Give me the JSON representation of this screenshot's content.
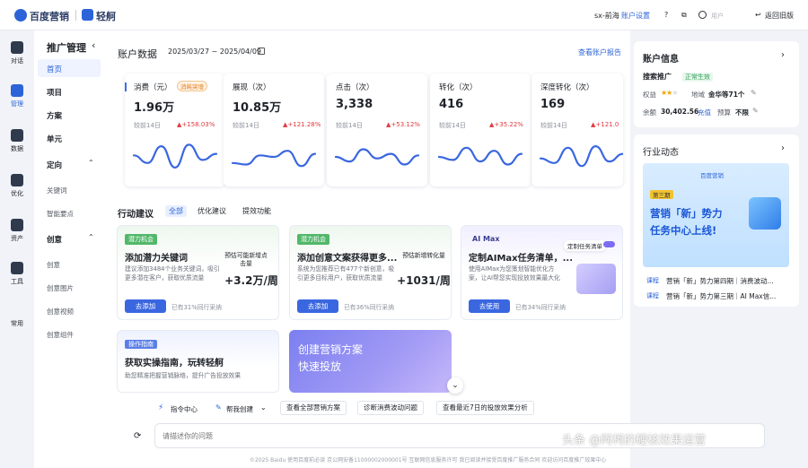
{
  "header": {
    "logo_text": "百度营销",
    "product": "轻舸",
    "account": "sx-前海",
    "account_settings": "账户设置",
    "user": "用户",
    "back_old": "返回旧版"
  },
  "rail": [
    {
      "label": "对话"
    },
    {
      "label": "管理"
    },
    {
      "label": "数据"
    },
    {
      "label": "优化"
    },
    {
      "label": "资产"
    },
    {
      "label": "工具"
    },
    {
      "label": "常用"
    }
  ],
  "nav": {
    "title": "推广管理",
    "items": [
      {
        "label": "首页"
      },
      {
        "label": "项目"
      },
      {
        "label": "方案"
      },
      {
        "label": "单元"
      },
      {
        "label": "定向"
      },
      {
        "label": "关键词"
      },
      {
        "label": "智能要点"
      },
      {
        "label": "创意"
      },
      {
        "label": "创意"
      },
      {
        "label": "创意图片"
      },
      {
        "label": "创意视频"
      },
      {
        "label": "创意组件"
      }
    ]
  },
  "data_section": {
    "title": "账户数据",
    "date_range": "2025/03/27 ~ 2025/04/09",
    "report_link": "查看账户报告"
  },
  "metrics": [
    {
      "label": "消费（元）",
      "badge": "消耗突增",
      "value": "1.96万",
      "compare": "较前14日",
      "change": "▲+158.03%"
    },
    {
      "label": "展现（次）",
      "value": "10.85万",
      "compare": "较前14日",
      "change": "▲+121.28%"
    },
    {
      "label": "点击（次）",
      "value": "3,338",
      "compare": "较前14日",
      "change": "▲+53.12%"
    },
    {
      "label": "转化（次）",
      "value": "416",
      "compare": "较前14日",
      "change": "▲+35.22%"
    },
    {
      "label": "深度转化（次）",
      "value": "169",
      "compare": "较前14日",
      "change": "▲+121.0"
    }
  ],
  "actions": {
    "title": "行动建议",
    "tabs": [
      {
        "label": "全部"
      },
      {
        "label": "优化建议"
      },
      {
        "label": "提效功能"
      }
    ],
    "cards": [
      {
        "tag": "潜力机会",
        "title": "添加潜力关键词",
        "desc": "建议添加3484个业务关键词，吸引更多潜在客户，获取优质流量",
        "pred_label": "预估可能新增点击量",
        "pred_value": "+3.2万/周",
        "button": "去添加",
        "peer": "已有31%同行采纳"
      },
      {
        "tag": "潜力机会",
        "title": "添加创意文案获得更多...",
        "desc": "系统为您推荐已有477个新创意，吸引更多目标用户，获取优质流量",
        "pred_label": "预估新增转化量",
        "pred_value": "+1031/周",
        "button": "去添加",
        "peer": "已有36%同行采纳"
      },
      {
        "tag": "AI Max",
        "title": "定制AIMax任务清单，...",
        "desc": "使用AIMax为您策划智能优化方案，让AI帮您实现投放效果最大化",
        "chip": "定制任务清单",
        "button": "去使用",
        "peer": "已有34%同行采纳"
      }
    ],
    "guide": {
      "tag": "操作指南",
      "title": "获取实操指南，玩转轻舸",
      "desc": "助您精准把握营销脉络，提升广告投放效果"
    },
    "banner": {
      "line1": "创建营销方案",
      "line2": "快速投放"
    }
  },
  "quick": [
    {
      "label": "指令中心"
    },
    {
      "label": "帮我创建"
    },
    {
      "label": "查看全部营销方案"
    },
    {
      "label": "诊断消费波动问题"
    },
    {
      "label": "查看最近7日的投放效果分析"
    }
  ],
  "chat": {
    "placeholder": "请描述你的问题"
  },
  "footer": "©2025 Baidu 使用百度前必读 京公网安备11000002000001号 互联网信息服务许可 我已阅读并接受百度推广服务合同 欢迎访问百度推广效果中心",
  "watermark": "头条 @阿柯的硬核效果运营",
  "account_info": {
    "title": "账户信息",
    "type_label": "搜索推广",
    "status": "正常生效",
    "rights_label": "权益",
    "region_label": "地域",
    "region": "金华等71个",
    "balance_label": "余额",
    "balance": "30,402.56",
    "recharge": "充值",
    "budget_label": "预算",
    "budget": "不限"
  },
  "industry": {
    "title": "行业动态",
    "banner_brand": "百度营销",
    "banner_tag": "第三期",
    "banner_title1": "营销「新」势力",
    "banner_title2": "任务中心上线!",
    "news": [
      {
        "tag": "课程",
        "text": "营销「新」势力第四期｜消费波动..."
      },
      {
        "tag": "课程",
        "text": "营销「新」势力第三期｜AI Max信..."
      }
    ]
  },
  "chart_data": [
    {
      "type": "line",
      "title": "消费（元）",
      "values": [
        0.55,
        0.3,
        0.85,
        0.15,
        0.9,
        0.4,
        0.6
      ]
    },
    {
      "type": "line",
      "title": "展现（次）",
      "values": [
        0.3,
        0.25,
        0.55,
        0.5,
        0.7,
        0.2,
        0.6
      ]
    },
    {
      "type": "line",
      "title": "点击（次）",
      "values": [
        0.5,
        0.35,
        0.75,
        0.45,
        0.6,
        0.25,
        0.55
      ]
    },
    {
      "type": "line",
      "title": "转化（次）",
      "values": [
        0.5,
        0.4,
        0.8,
        0.35,
        0.7,
        0.25,
        0.6
      ]
    },
    {
      "type": "line",
      "title": "深度转化（次）",
      "values": [
        0.45,
        0.3,
        0.8,
        0.2,
        0.85,
        0.35,
        0.6
      ]
    }
  ],
  "colors": {
    "accent": "#3a67e0",
    "up": "#e0393e",
    "green": "#52b86a"
  }
}
